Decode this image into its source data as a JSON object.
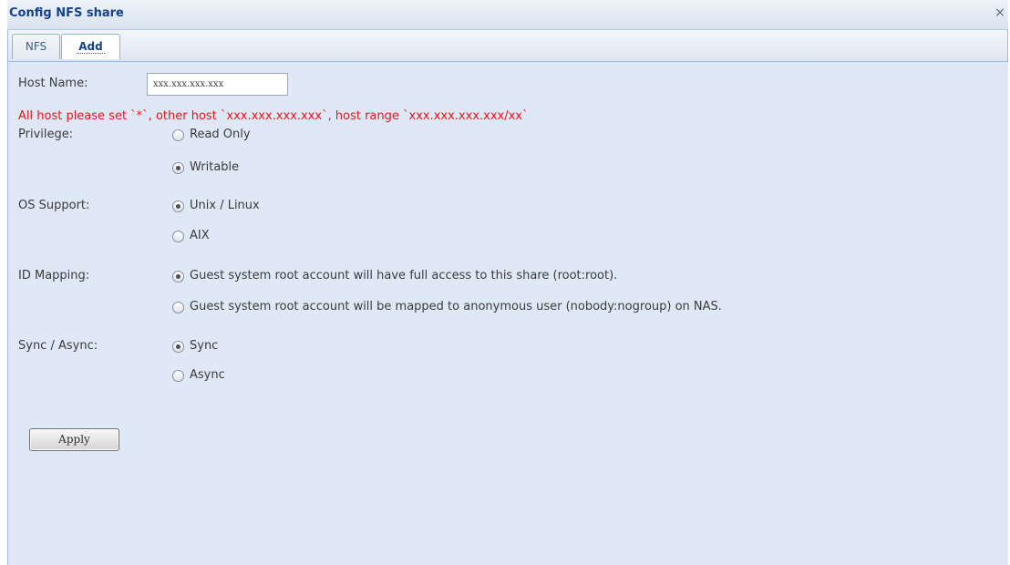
{
  "window": {
    "title": "Config NFS share",
    "close_glyph": "×"
  },
  "tabs": [
    {
      "label": "NFS",
      "active": false
    },
    {
      "label": "Add",
      "active": true
    }
  ],
  "form": {
    "host_name": {
      "label": "Host Name:",
      "value": "xxx.xxx.xxx.xxx"
    },
    "hint": "All host please set `*`, other host `xxx.xxx.xxx.xxx`, host range `xxx.xxx.xxx.xxx/xx`",
    "privilege": {
      "label": "Privilege:",
      "options": [
        {
          "label": "Read Only",
          "checked": false
        },
        {
          "label": "Writable",
          "checked": true
        }
      ]
    },
    "os_support": {
      "label": "OS Support:",
      "options": [
        {
          "label": "Unix / Linux",
          "checked": true
        },
        {
          "label": "AIX",
          "checked": false
        }
      ]
    },
    "id_mapping": {
      "label": "ID Mapping:",
      "options": [
        {
          "label": "Guest system root account will have full access to this share (root:root).",
          "checked": true
        },
        {
          "label": "Guest system root account will be mapped to anonymous user (nobody:nogroup) on NAS.",
          "checked": false
        }
      ]
    },
    "sync_async": {
      "label": "Sync / Async:",
      "options": [
        {
          "label": "Sync",
          "checked": true
        },
        {
          "label": "Async",
          "checked": false
        }
      ]
    },
    "apply_label": "Apply"
  },
  "colors": {
    "title_text": "#15428b",
    "hint_text": "#e8151b",
    "panel_bg": "#dfe8f6"
  },
  "icons": {
    "close": "close-icon",
    "radio": "radio-button-icon"
  }
}
